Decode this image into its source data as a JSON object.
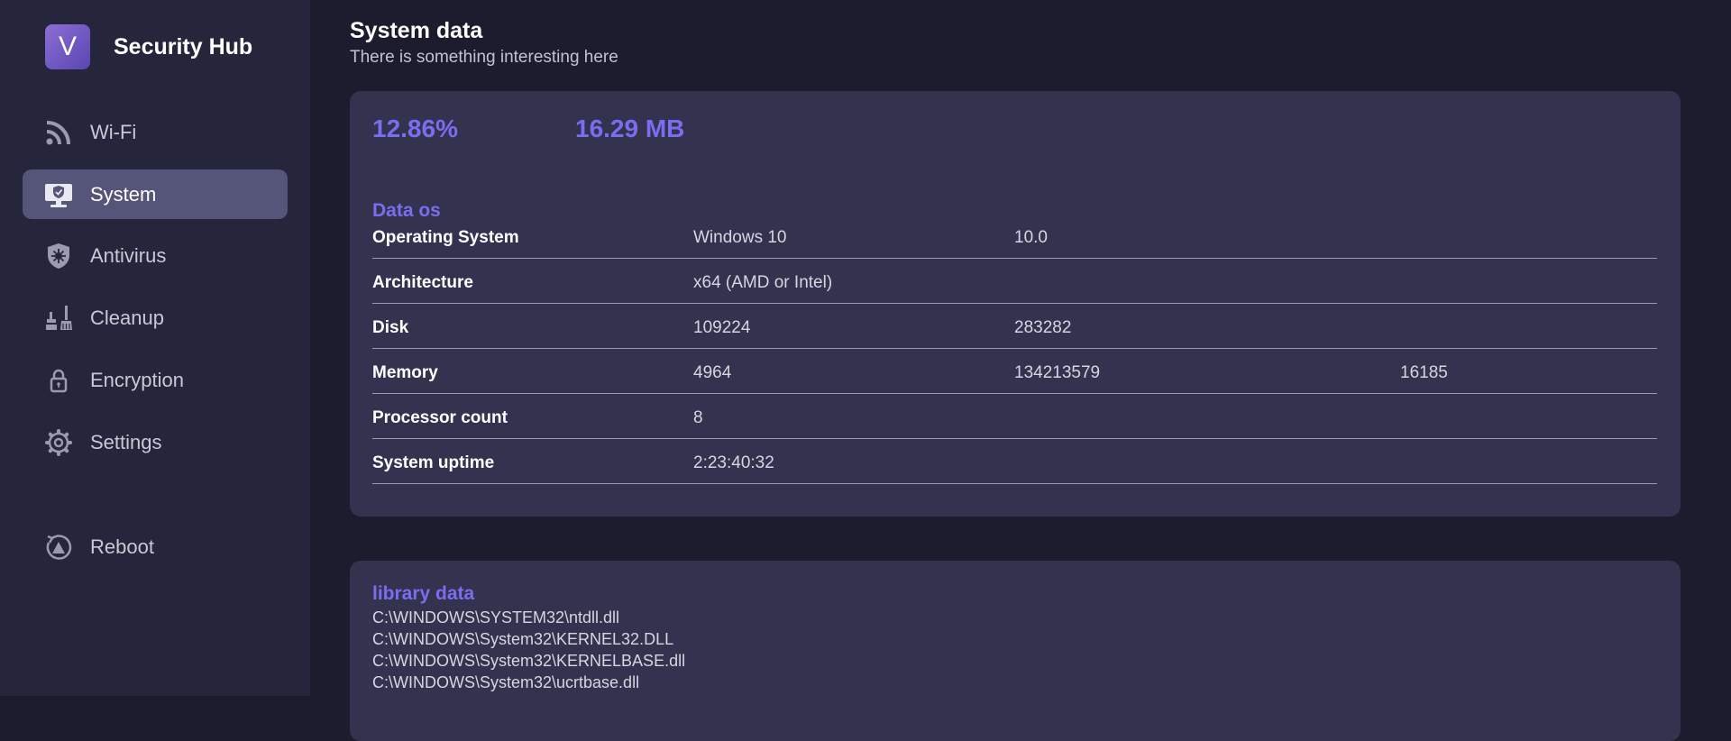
{
  "app": {
    "logo_letter": "V",
    "title": "Security Hub"
  },
  "sidebar": {
    "items": [
      {
        "label": "Wi-Fi",
        "icon": "wifi-icon"
      },
      {
        "label": "System",
        "icon": "monitor-shield-icon",
        "active": true
      },
      {
        "label": "Antivirus",
        "icon": "shield-virus-icon"
      },
      {
        "label": "Cleanup",
        "icon": "broom-icon"
      },
      {
        "label": "Encryption",
        "icon": "lock-icon"
      },
      {
        "label": "Settings",
        "icon": "gear-icon"
      },
      {
        "label": "Reboot",
        "icon": "reboot-icon"
      }
    ]
  },
  "main": {
    "title": "System data",
    "subtitle": "There is something interesting here",
    "stats": {
      "cpu": "12.86%",
      "memory": "16.29 MB"
    },
    "os_section": {
      "title": "Data os",
      "rows": [
        {
          "key": "Operating System",
          "v1": "Windows 10",
          "v2": "10.0",
          "v3": ""
        },
        {
          "key": "Architecture",
          "v1": "x64 (AMD or Intel)",
          "v2": "",
          "v3": ""
        },
        {
          "key": "Disk",
          "v1": "109224",
          "v2": "283282",
          "v3": ""
        },
        {
          "key": "Memory",
          "v1": "4964",
          "v2": "134213579",
          "v3": "16185"
        },
        {
          "key": "Processor count",
          "v1": "8",
          "v2": "",
          "v3": ""
        },
        {
          "key": "System uptime",
          "v1": "2:23:40:32",
          "v2": "",
          "v3": ""
        }
      ]
    },
    "library_section": {
      "title": "library data",
      "items": [
        "C:\\WINDOWS\\SYSTEM32\\ntdll.dll",
        "C:\\WINDOWS\\System32\\KERNEL32.DLL",
        "C:\\WINDOWS\\System32\\KERNELBASE.dll",
        "C:\\WINDOWS\\System32\\ucrtbase.dll"
      ]
    }
  },
  "colors": {
    "accent": "#7b6cf0",
    "sidebar_bg": "#25253b",
    "card_bg": "#333350",
    "page_bg": "#1c1c2e"
  }
}
